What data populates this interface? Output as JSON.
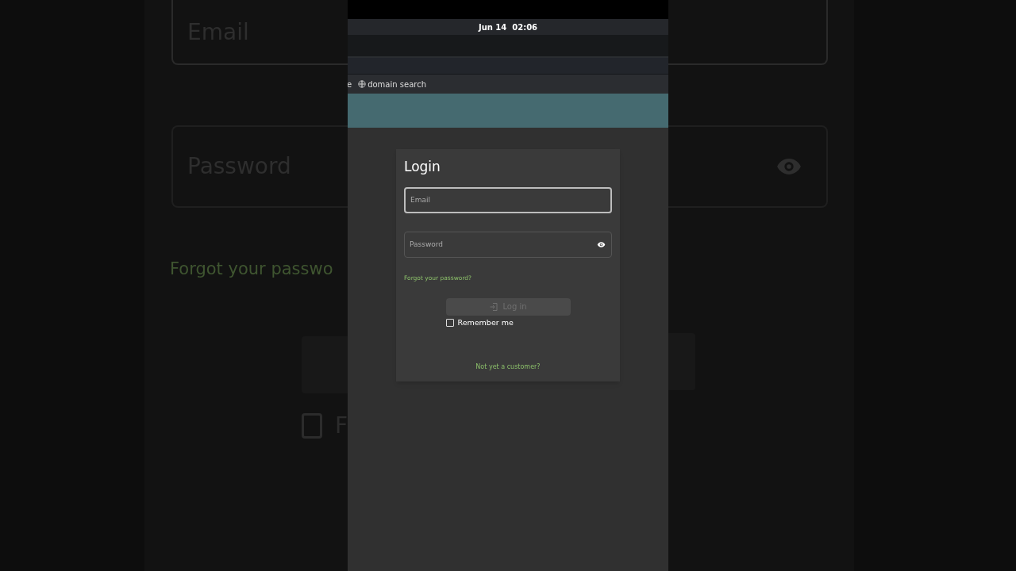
{
  "backdrop": {
    "email_placeholder": "Email",
    "password_placeholder": "Password",
    "forgot_link": "Forgot your passwo",
    "remember_label": "F"
  },
  "status_bar": {
    "datetime": "Jun 14  02:06"
  },
  "toolbar": {
    "items": [
      {
        "kind": "text",
        "label": "e"
      },
      {
        "kind": "globe",
        "label": "domain search"
      }
    ]
  },
  "login": {
    "title": "Login",
    "fields": [
      {
        "kind": "email",
        "placeholder": "Email",
        "focused": true
      },
      {
        "kind": "password",
        "placeholder": "Password",
        "focused": false
      }
    ],
    "forgot_link": "Forgot your password?",
    "login_button": {
      "label": "Log in",
      "disabled": true
    },
    "remember": {
      "label": "Remember me",
      "checked": false
    },
    "signup_link": "Not yet a customer?"
  }
}
